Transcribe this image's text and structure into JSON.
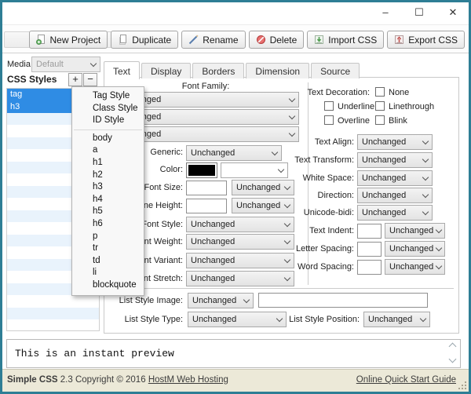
{
  "window": {
    "controls": {
      "minimize": "–",
      "maximize": "☐",
      "close": "✕"
    }
  },
  "toolbar": {
    "buttons": [
      {
        "label": "New Project",
        "icon": "new-project-icon"
      },
      {
        "label": "Duplicate",
        "icon": "duplicate-icon"
      },
      {
        "label": "Rename",
        "icon": "rename-icon"
      },
      {
        "label": "Delete",
        "icon": "delete-icon"
      },
      {
        "label": "Import CSS",
        "icon": "import-icon"
      },
      {
        "label": "Export CSS",
        "icon": "export-icon"
      }
    ]
  },
  "sidebar": {
    "media_label": "Media:",
    "media_value": "Default",
    "styles_header": "CSS Styles",
    "add_button": "+",
    "remove_button": "−",
    "styles": [
      "tag",
      "h3"
    ],
    "selected_color": "#2f8ce4"
  },
  "style_menu": {
    "actions": [
      "Tag Style",
      "Class Style",
      "ID Style"
    ],
    "tags": [
      "body",
      "a",
      "h1",
      "h2",
      "h3",
      "h4",
      "h5",
      "h6",
      "p",
      "tr",
      "td",
      "li",
      "blockquote"
    ]
  },
  "tabs": {
    "items": [
      "Text",
      "Display",
      "Borders",
      "Dimension",
      "Source"
    ],
    "active": "Text"
  },
  "text_tab": {
    "font_family_label": "Font Family:",
    "family_1": "Unchanged",
    "family_2": "Unchanged",
    "family_3": "Unchanged",
    "generic_label": "Generic:",
    "generic_value": "Unchanged",
    "color_label": "Color:",
    "swatch_color": "#000000",
    "color_combo_value": "",
    "font_size_label": "Font Size:",
    "font_size_value": "",
    "font_size_unit": "Unchanged",
    "line_height_label": "Line Height:",
    "line_height_value": "",
    "line_height_unit": "Unchanged",
    "font_style_label": "Font Style:",
    "font_style_value": "Unchanged",
    "font_weight_label": "Font Weight:",
    "font_weight_value": "Unchanged",
    "font_variant_label": "Font Variant:",
    "font_variant_value": "Unchanged",
    "font_stretch_label": "Font Stretch:",
    "font_stretch_value": "Unchanged",
    "decoration_label": "Text Decoration:",
    "decoration_options": [
      "None",
      "Underline",
      "Linethrough",
      "Overline",
      "Blink"
    ],
    "text_align_label": "Text Align:",
    "text_align_value": "Unchanged",
    "text_transform_label": "Text Transform:",
    "text_transform_value": "Unchanged",
    "white_space_label": "White Space:",
    "white_space_value": "Unchanged",
    "direction_label": "Direction:",
    "direction_value": "Unchanged",
    "unicode_bidi_label": "Unicode-bidi:",
    "unicode_bidi_value": "Unchanged",
    "text_indent_label": "Text Indent:",
    "text_indent_value": "",
    "text_indent_unit": "Unchanged",
    "letter_spacing_label": "Letter Spacing:",
    "letter_spacing_value": "",
    "letter_spacing_unit": "Unchanged",
    "word_spacing_label": "Word Spacing:",
    "word_spacing_value": "",
    "word_spacing_unit": "Unchanged",
    "list_style_image_label": "List Style Image:",
    "list_style_image_value": "Unchanged",
    "list_style_image_url": "",
    "list_style_type_label": "List Style Type:",
    "list_style_type_value": "Unchanged",
    "list_style_position_label": "List Style Position:",
    "list_style_position_value": "Unchanged"
  },
  "preview": {
    "text": "This is an instant preview"
  },
  "statusbar": {
    "app_name": "Simple CSS",
    "version_text": " 2.3 Copyright © 2016 ",
    "vendor_link": "HostM Web Hosting",
    "help_link": "Online Quick Start Guide"
  }
}
